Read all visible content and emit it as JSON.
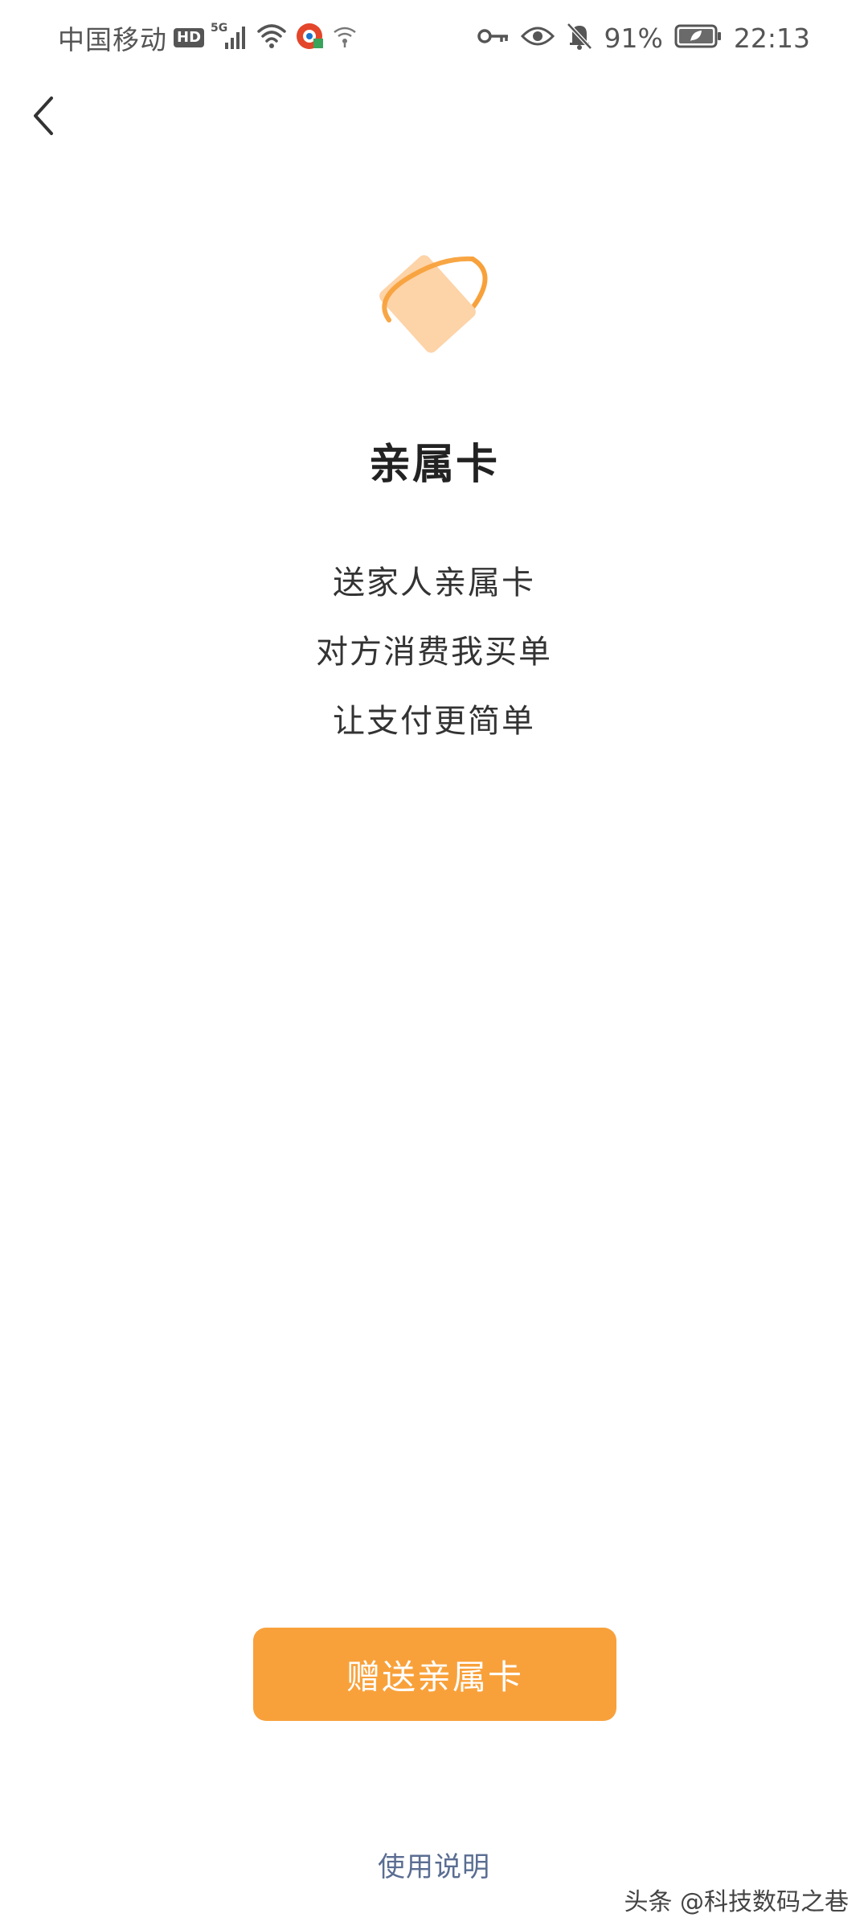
{
  "status_bar": {
    "carrier": "中国移动",
    "hd_badge": "HD",
    "network": "5G",
    "battery_percent": "91%",
    "time": "22:13",
    "icons": [
      "hd-icon",
      "signal-5g-icon",
      "wifi-icon",
      "vpn-icon",
      "hotspot-icon",
      "key-icon",
      "eye-icon",
      "bell-off-icon",
      "battery-icon"
    ]
  },
  "nav": {
    "back_icon": "chevron-left-icon"
  },
  "hero": {
    "icon": "card-orbit-icon",
    "accent_color": "#f8a13b",
    "card_color": "#fdd3a8"
  },
  "main": {
    "title": "亲属卡",
    "lines": [
      "送家人亲属卡",
      "对方消费我买单",
      "让支付更简单"
    ]
  },
  "actions": {
    "gift_button_label": "赠送亲属卡",
    "gift_button_color": "#f8a13b",
    "help_link_label": "使用说明",
    "help_link_color": "#5a6d92"
  },
  "watermark": {
    "text": "头条 @科技数码之巷"
  }
}
